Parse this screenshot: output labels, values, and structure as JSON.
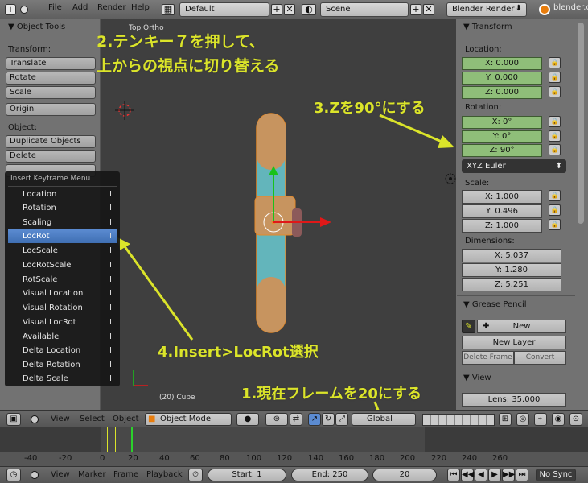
{
  "topbar": {
    "menus": [
      "File",
      "Add",
      "Render",
      "Help"
    ],
    "screen_layout": "Default",
    "scene": "Scene",
    "engine": "Blender Render",
    "site": "blender.o"
  },
  "left": {
    "title": "Object Tools",
    "transform_label": "Transform:",
    "transform_buttons": [
      "Translate",
      "Rotate",
      "Scale"
    ],
    "origin": "Origin",
    "object_label": "Object:",
    "object_buttons": [
      "Duplicate Objects",
      "Delete"
    ]
  },
  "viewport": {
    "view_label": "Top Ortho",
    "object_label": "(20) Cube"
  },
  "popup": {
    "title": "Insert Keyframe Menu",
    "items": [
      "Location",
      "Rotation",
      "Scaling",
      "LocRot",
      "LocScale",
      "LocRotScale",
      "RotScale",
      "Visual Location",
      "Visual Rotation",
      "Visual LocRot",
      "Available",
      "Delta Location",
      "Delta Rotation",
      "Delta Scale"
    ],
    "key": "I"
  },
  "right": {
    "title": "Transform",
    "location_label": "Location:",
    "location": [
      "X: 0.000",
      "Y: 0.000",
      "Z: 0.000"
    ],
    "rotation_label": "Rotation:",
    "rotation": [
      "X: 0°",
      "Y: 0°",
      "Z: 90°"
    ],
    "euler": "XYZ Euler",
    "scale_label": "Scale:",
    "scale": [
      "X: 1.000",
      "Y: 0.496",
      "Z: 1.000"
    ],
    "dimensions_label": "Dimensions:",
    "dimensions": [
      "X: 5.037",
      "Y: 1.280",
      "Z: 5.251"
    ],
    "grease_title": "Grease Pencil",
    "new": "New",
    "new_layer": "New Layer",
    "delete_frame": "Delete Frame",
    "convert": "Convert",
    "view_title": "View",
    "lens": "Lens: 35.000"
  },
  "annotations": {
    "a2_line1": "2.テンキー７を押して、",
    "a2_line2": "上からの視点に切り替える",
    "a3": "3.Zを90°にする",
    "a4": "4.Insert>LocRot選択",
    "a1": "1.現在フレームを20にする"
  },
  "view3d_header": {
    "menus": [
      "View",
      "Select",
      "Object"
    ],
    "mode": "Object Mode",
    "orientation": "Global"
  },
  "timeline": {
    "ticks": [
      "-40",
      "-20",
      "0",
      "20",
      "40",
      "60",
      "80",
      "100",
      "120",
      "140",
      "160",
      "180",
      "200",
      "220",
      "240",
      "260"
    ],
    "menus": [
      "View",
      "Marker",
      "Frame",
      "Playback"
    ],
    "start": "Start: 1",
    "end": "End: 250",
    "current": "20",
    "sync": "No Sync"
  },
  "colors": {
    "annotation": "#dbe42a",
    "green_field": "#8fbe79",
    "menu_highlight": "#4a7cc2"
  }
}
